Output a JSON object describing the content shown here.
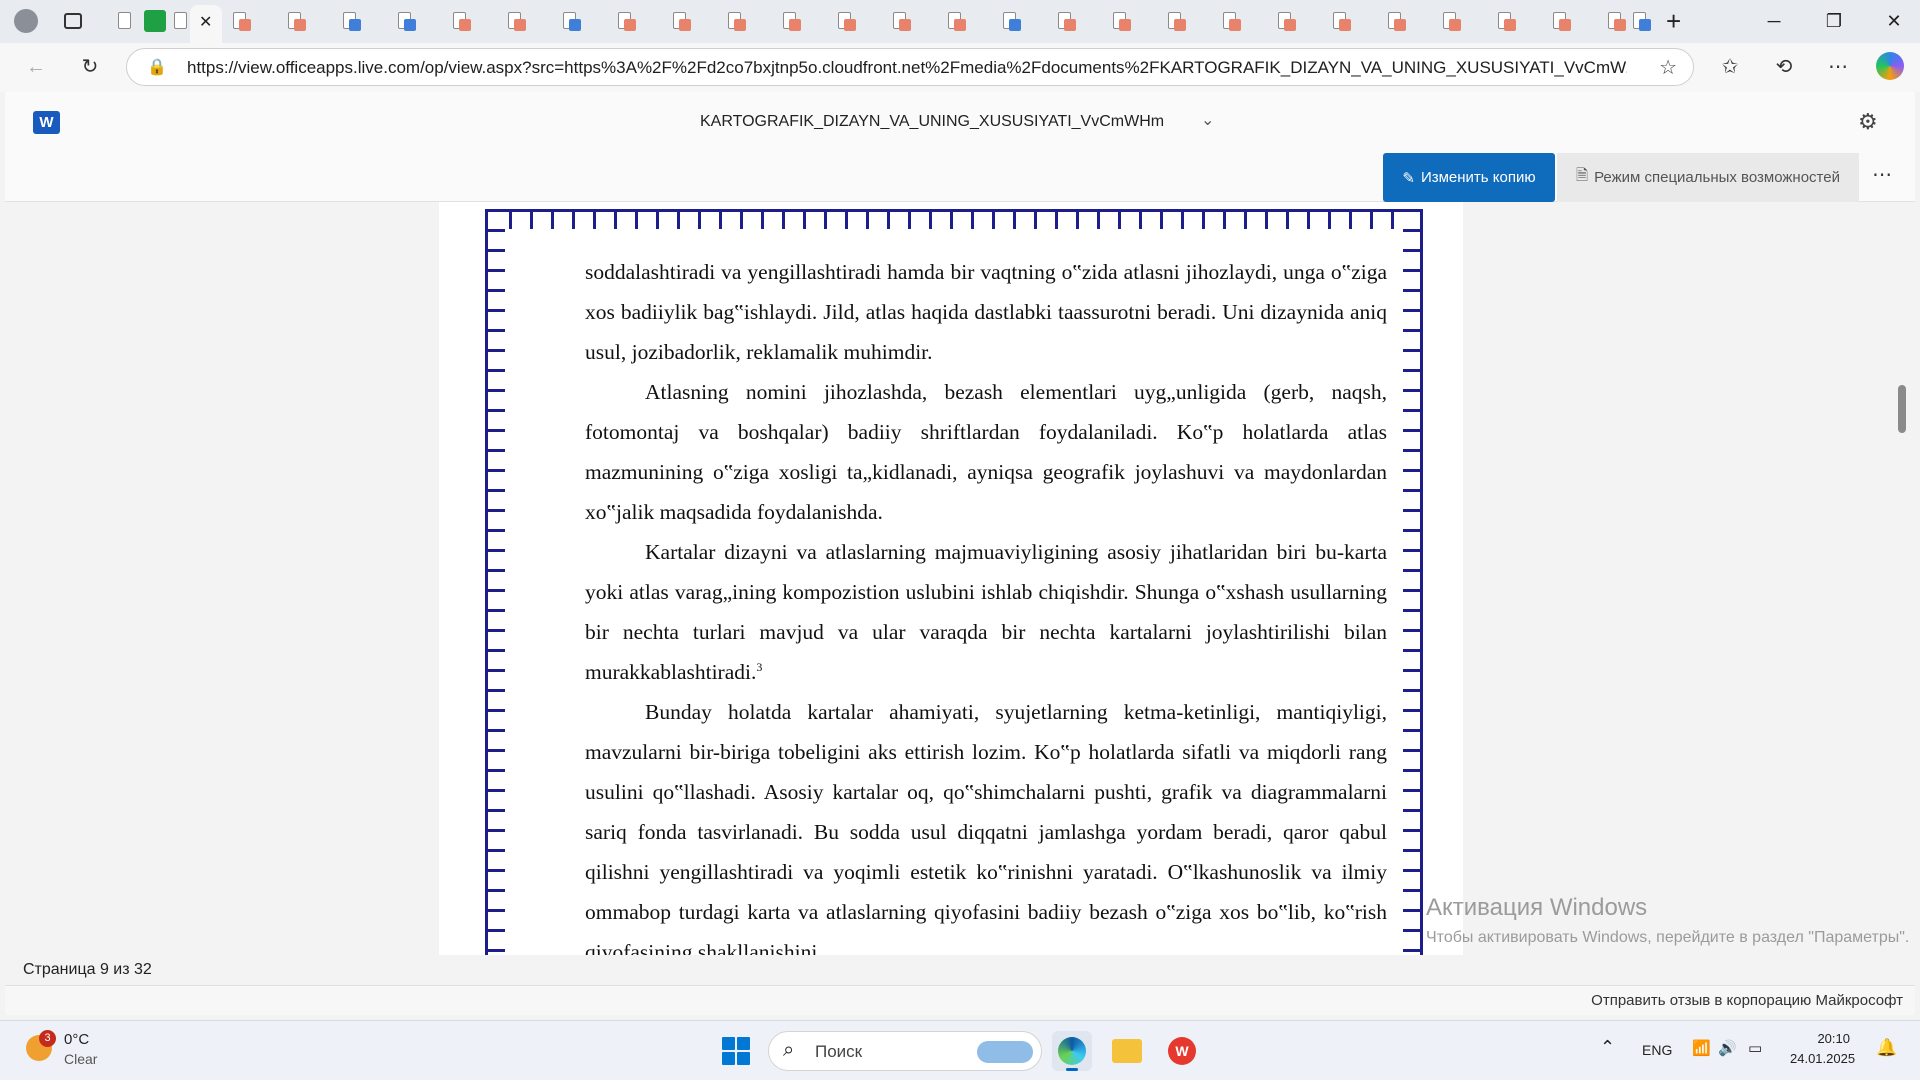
{
  "browser": {
    "url": "https://view.officeapps.live.com/op/view.aspx?src=https%3A%2F%2Fd2co7bxjtnp5o.cloudfront.net%2Fmedia%2Fdocuments%2FKARTOGRAFIK_DIZAYN_VA_UNING_XUSUSIYATI_VvCmW..."
  },
  "office": {
    "doc_title": "KARTOGRAFIK_DIZAYN_VA_UNING_XUSUSIYATI_VvCmWHm",
    "edit_copy_label": "Изменить копию",
    "accessibility_label": "Режим специальных возможностей"
  },
  "document": {
    "paragraphs": [
      "soddalashtiradi va yengillashtiradi hamda bir vaqtning o‟zida atlasni jihozlaydi, unga o‟ziga xos badiiylik bag‟ishlaydi. Jild, atlas haqida dastlabki taassurotni beradi. Uni dizaynida aniq usul, jozibadorlik, reklamalik muhimdir.",
      "Atlasning nomini jihozlashda, bezash elementlari uyg„unligida (gerb, naqsh, fotomontaj va boshqalar) badiiy shriftlardan foydalaniladi. Ko‟p holatlarda atlas mazmunining o‟ziga xosligi ta„kidlanadi, ayniqsa geografik joylashuvi va maydonlardan xo‟jalik maqsadida foydalanishda.",
      "Kartalar dizayni va atlaslarning majmuaviyligining asosiy jihatlaridan biri bu-karta yoki atlas varag„ining kompozistion uslubini ishlab chiqishdir. Shunga o‟xshash usullarning bir nechta turlari mavjud va ular varaqda bir nechta kartalarni joylashtirilishi bilan murakkablashtiradi.",
      "Bunday holatda kartalar ahamiyati, syujetlarning ketma-ketinligi, mantiqiyligi, mavzularni bir-biriga tobeligini aks ettirish lozim. Ko‟p holatlarda sifatli va miqdorli rang usulini qo‟llashadi. Asosiy kartalar oq, qo‟shimchalarni pushti, grafik va diagrammalarni sariq fonda tasvirlanadi. Bu sodda usul diqqatni jamlashga yordam beradi, qaror qabul qilishni yengillashtiradi va yoqimli estetik ko‟rinishni yaratadi. O‟lkashunoslik va ilmiy ommabop turdagi karta va atlaslarning qiyofasini badiiy bezash o‟ziga xos bo‟lib, ko‟rish qiyofasining shakllanishini"
    ],
    "footnote_ref": "3"
  },
  "status": {
    "page_indicator": "Страница 9 из 32",
    "feedback": "Отправить отзыв в корпорацию Майкрософт"
  },
  "activation": {
    "title": "Активация Windows",
    "subtitle": "Чтобы активировать Windows, перейдите в раздел \"Параметры\"."
  },
  "taskbar": {
    "weather_temp": "0°C",
    "weather_cond": "Clear",
    "weather_badge": "3",
    "search_placeholder": "Поиск",
    "lang": "ENG",
    "time": "20:10",
    "date": "24.01.2025"
  },
  "colors": {
    "accent": "#0f6cbd",
    "frame": "#1d1d8c"
  }
}
